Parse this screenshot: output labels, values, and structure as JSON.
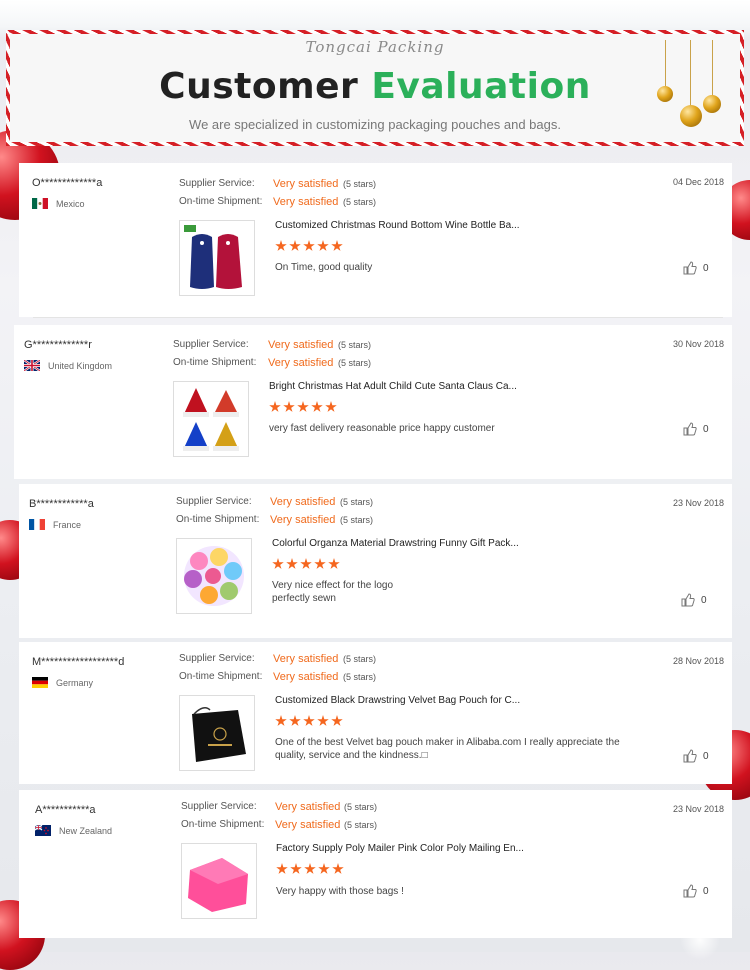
{
  "header": {
    "brand": "Tongcai Packing",
    "title_main": "Customer",
    "title_accent": "Evaluation",
    "subtitle": "We are specialized in customizing packaging pouches and bags."
  },
  "labels": {
    "supplier_service": "Supplier Service:",
    "ontime_shipment": "On-time Shipment:"
  },
  "colors": {
    "accent_green": "#2bb05a",
    "accent_orange": "#f06a1c",
    "star": "#f5661f"
  },
  "reviews": [
    {
      "user": "O*************a",
      "country": "Mexico",
      "flag": "mexico-flag",
      "supplier_service": "Very satisfied",
      "supplier_stars": "(5 stars)",
      "shipment": "Very satisfied",
      "shipment_stars": "(5 stars)",
      "date": "04 Dec 2018",
      "product": "Customized Christmas Round Bottom Wine Bottle Ba...",
      "rating": 5,
      "comment": "On Time, good quality",
      "likes": "0"
    },
    {
      "user": "G*************r",
      "country": "United Kingdom",
      "flag": "uk-flag",
      "supplier_service": "Very satisfied",
      "supplier_stars": "(5 stars)",
      "shipment": "Very satisfied",
      "shipment_stars": "(5 stars)",
      "date": "30 Nov 2018",
      "product": "Bright Christmas Hat Adult Child Cute Santa Claus Ca...",
      "rating": 5,
      "comment": "very fast delivery reasonable price happy customer",
      "likes": "0"
    },
    {
      "user": "B************a",
      "country": "France",
      "flag": "france-flag",
      "supplier_service": "Very satisfied",
      "supplier_stars": "(5 stars)",
      "shipment": "Very satisfied",
      "shipment_stars": "(5 stars)",
      "date": "23 Nov 2018",
      "product": "Colorful Organza Material Drawstring Funny Gift Pack...",
      "rating": 5,
      "comment_line1": "Very nice effect for the logo",
      "comment_line2": "perfectly sewn",
      "likes": "0"
    },
    {
      "user": "M******************d",
      "country": "Germany",
      "flag": "germany-flag",
      "supplier_service": "Very satisfied",
      "supplier_stars": "(5 stars)",
      "shipment": "Very satisfied",
      "shipment_stars": "(5 stars)",
      "date": "28 Nov 2018",
      "product": "Customized Black Drawstring Velvet Bag Pouch for C...",
      "rating": 5,
      "comment_line1": "One of the best Velvet bag pouch maker in Alibaba.com I really appreciate the",
      "comment_line2": "quality, service and the kindness.□",
      "likes": "0"
    },
    {
      "user": "A***********a",
      "country": "New Zealand",
      "flag": "new-zealand-flag",
      "supplier_service": "Very satisfied",
      "supplier_stars": "(5 stars)",
      "shipment": "Very satisfied",
      "shipment_stars": "(5 stars)",
      "date": "23 Nov 2018",
      "product": "Factory Supply Poly Mailer Pink Color Poly Mailing En...",
      "rating": 5,
      "comment": "Very happy with those bags !",
      "likes": "0"
    }
  ]
}
